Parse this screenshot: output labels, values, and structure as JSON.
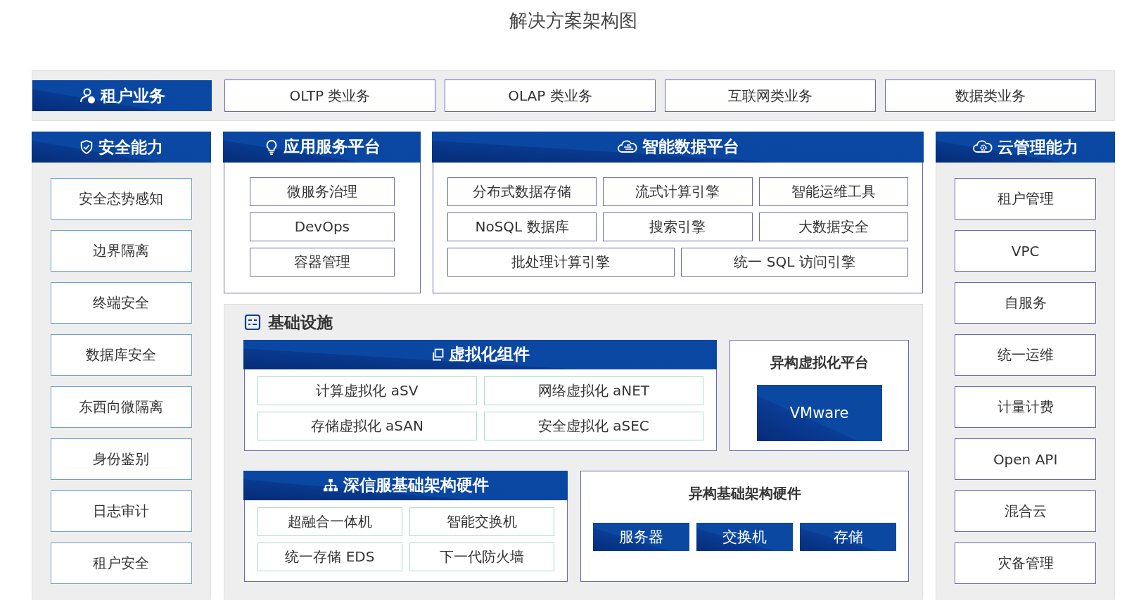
{
  "title": "解决方案架构图",
  "tenant_bar": {
    "label": "租户业务",
    "items": [
      "OLTP 类业务",
      "OLAP 类业务",
      "互联网类业务",
      "数据类业务"
    ]
  },
  "security": {
    "title": "安全能力",
    "items": [
      "安全态势感知",
      "边界隔离",
      "终端安全",
      "数据库安全",
      "东西向微隔离",
      "身份鉴别",
      "日志审计",
      "租户安全"
    ]
  },
  "app_platform": {
    "title": "应用服务平台",
    "items": [
      "微服务治理",
      "DevOps",
      "容器管理"
    ]
  },
  "data_platform": {
    "title": "智能数据平台",
    "items": [
      "分布式数据存储",
      "流式计算引擎",
      "智能运维工具",
      "NoSQL 数据库",
      "搜索引擎",
      "大数据安全",
      "批处理计算引擎",
      "统一 SQL 访问引擎"
    ]
  },
  "cloud_mgmt": {
    "title": "云管理能力",
    "items": [
      "租户管理",
      "VPC",
      "自服务",
      "统一运维",
      "计量计费",
      "Open API",
      "混合云",
      "灾备管理"
    ]
  },
  "infrastructure": {
    "title": "基础设施",
    "virtualization": {
      "title": "虚拟化组件",
      "items": [
        "计算虚拟化 aSV",
        "网络虚拟化 aNET",
        "存储虚拟化 aSAN",
        "安全虚拟化 aSEC"
      ]
    },
    "hetero_virt": {
      "title": "异构虚拟化平台",
      "items": [
        "VMware"
      ]
    },
    "hardware": {
      "title": "深信服基础架构硬件",
      "items": [
        "超融合一体机",
        "智能交换机",
        "统一存储 EDS",
        "下一代防火墙"
      ]
    },
    "hetero_hw": {
      "title": "异构基础架构硬件",
      "items": [
        "服务器",
        "交换机",
        "存储"
      ]
    }
  }
}
